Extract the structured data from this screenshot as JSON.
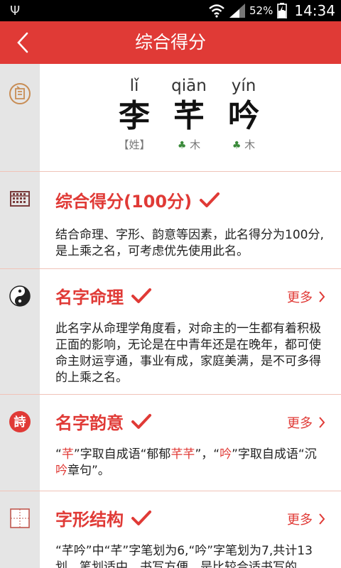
{
  "status_bar": {
    "battery": "52%",
    "time": "14:34"
  },
  "header": {
    "title": "综合得分"
  },
  "name": {
    "chars": [
      {
        "pinyin": "lǐ",
        "hanzi": "李",
        "attr": "【姓】",
        "element": ""
      },
      {
        "pinyin": "qiān",
        "hanzi": "芊",
        "attr": "木",
        "element": "tree"
      },
      {
        "pinyin": "yín",
        "hanzi": "吟",
        "attr": "木",
        "element": "tree"
      }
    ]
  },
  "sections": {
    "score": {
      "title": "综合得分(100分)",
      "desc": "结合命理、字形、韵意等因素，此名得分为100分,是上乘之名，可考虑优先使用此名。"
    },
    "mingli": {
      "title": "名字命理",
      "more": "更多",
      "desc": "此名字从命理学角度看，对命主的一生都有着积极正面的影响，无论是在中青年还是在晚年，都可使命主财运亨通，事业有成，家庭美满，是不可多得的上乘之名。"
    },
    "yunyi": {
      "title": "名字韵意",
      "more": "更多",
      "desc_parts": [
        "“",
        "芊",
        "”字取自成语“郁郁",
        "芊芊",
        "”，“",
        "吟",
        "”字取自成语“沉",
        "吟",
        "章句”。"
      ]
    },
    "zixing": {
      "title": "字形结构",
      "more": "更多",
      "desc": "“芊吟”中“芊”字笔划为6,“吟”字笔划为7,共计13划，笔划适中，书写方便，是比较合适书写的"
    }
  },
  "colors": {
    "accent": "#e03a36",
    "side": "#e5e5e5",
    "divider": "#f0c3b8"
  }
}
